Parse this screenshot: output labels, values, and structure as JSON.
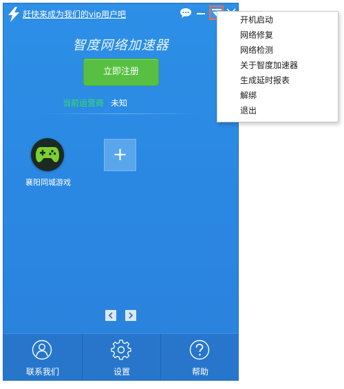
{
  "header": {
    "vip_link": "赶快来成为我们的vip用户吧"
  },
  "app": {
    "title": "智度网络加速器",
    "register_label": "立即注册",
    "carrier_label": "当前运营商",
    "carrier_value": "未知"
  },
  "games": [
    {
      "label": "襄阳同城游戏",
      "icon": "gamepad-icon"
    }
  ],
  "add_label": "+",
  "pager": {
    "prev_icon": "chevron-left-icon",
    "next_icon": "chevron-right-icon"
  },
  "bottom_nav": [
    {
      "label": "联系我们",
      "icon": "contact-icon"
    },
    {
      "label": "设置",
      "icon": "gear-icon"
    },
    {
      "label": "帮助",
      "icon": "help-icon"
    }
  ],
  "menu": {
    "items": [
      {
        "label": "开机启动"
      },
      {
        "label": "网络修复"
      },
      {
        "label": "网络检测"
      },
      {
        "label": "关于智度加速器"
      },
      {
        "label": "生成延时报表"
      },
      {
        "label": "解绑"
      },
      {
        "label": "退出"
      }
    ]
  },
  "colors": {
    "background": "#2a87e2",
    "register_green": "#57c042",
    "carrier_green": "#35e35e",
    "highlight_orange": "#ff6a3d"
  }
}
